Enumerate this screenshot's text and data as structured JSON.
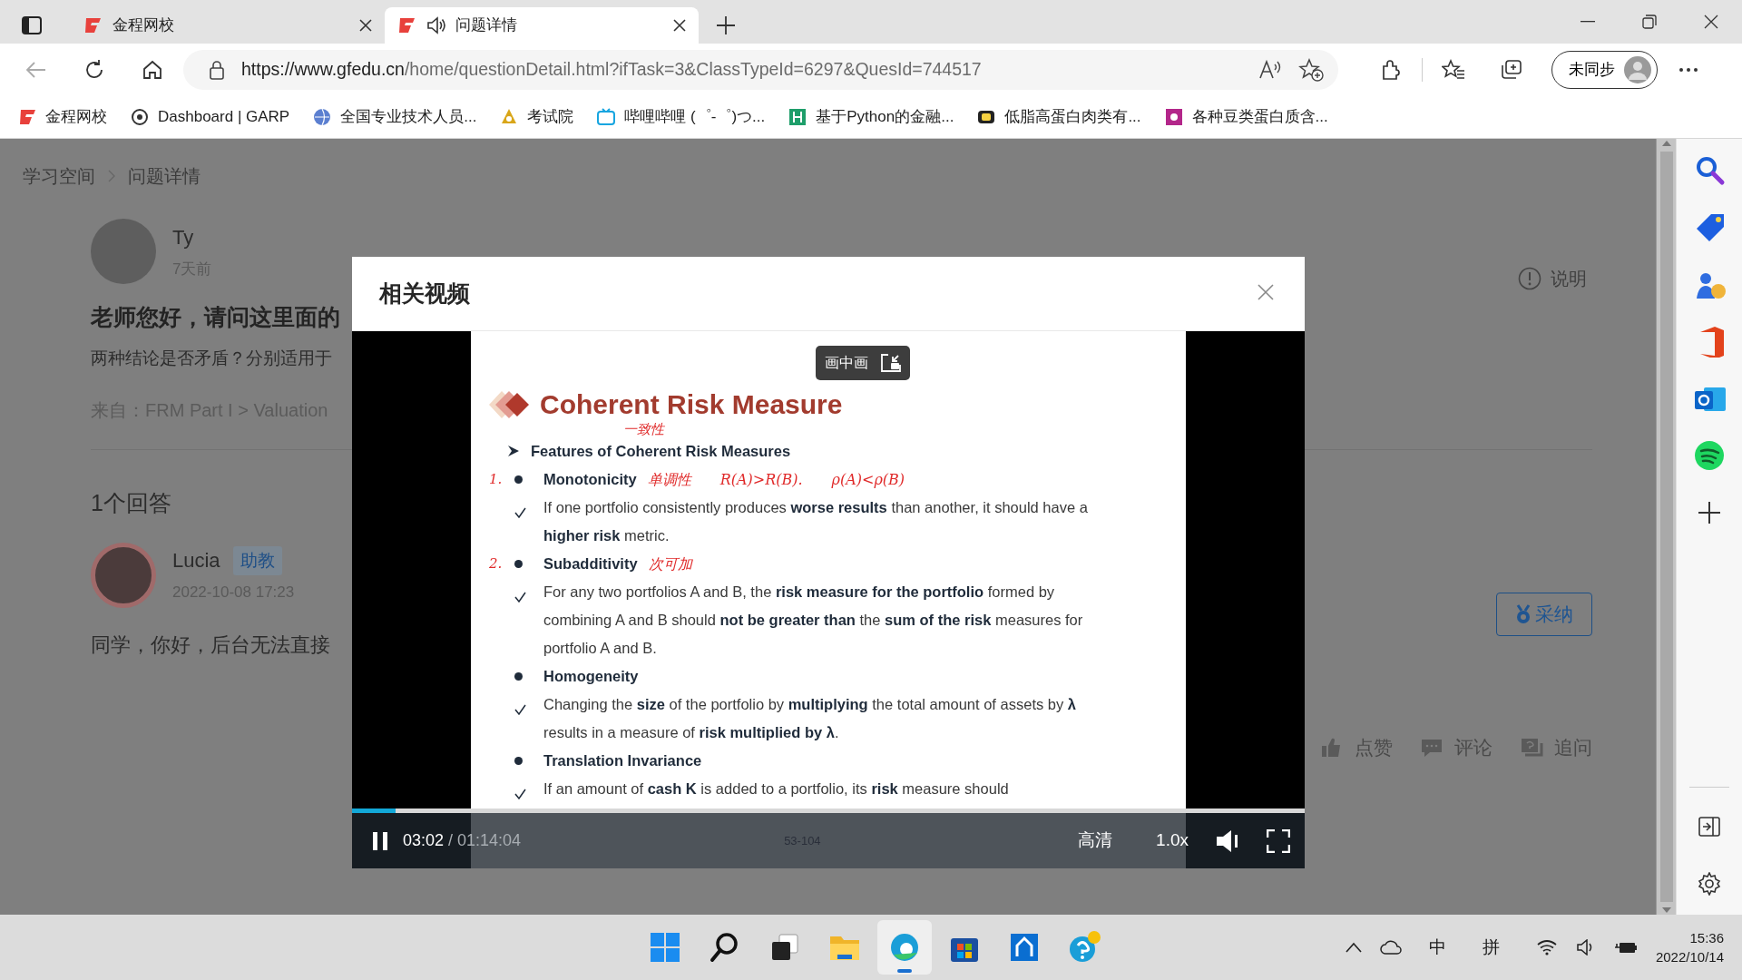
{
  "browser": {
    "tabs": [
      {
        "title": "金程网校",
        "selected": false,
        "audio": false
      },
      {
        "title": "问题详情",
        "selected": true,
        "audio": true
      }
    ],
    "address": {
      "host": "https://www.gfedu.cn",
      "path": "/home/questionDetail.html?ifTask=3&ClassTypeId=6297&QuesId=744517"
    },
    "profile": "未同步",
    "bookmarks": [
      {
        "title": "金程网校"
      },
      {
        "title": "Dashboard | GARP"
      },
      {
        "title": "全国专业技术人员..."
      },
      {
        "title": "考试院"
      },
      {
        "title": "哔哩哔哩 (゜-゜)つ..."
      },
      {
        "title": "基于Python的金融..."
      },
      {
        "title": "低脂高蛋白肉类有..."
      },
      {
        "title": "各种豆类蛋白质含..."
      }
    ]
  },
  "page": {
    "breadcrumb": [
      "学习空间",
      "问题详情"
    ],
    "help": "说明",
    "question": {
      "author": "Ty",
      "time": "7天前",
      "title": "老师您好，请问这里面的",
      "body": "两种结论是否矛盾？分别适用于",
      "source": "来自：FRM Part I > Valuation"
    },
    "answers_heading": "1个回答",
    "answer": {
      "author": "Lucia",
      "role": "助教",
      "time": "2022-10-08 17:23",
      "text": "同学，你好，后台无法直接",
      "accept": "采纳",
      "actions": [
        "点赞",
        "评论",
        "追问"
      ]
    }
  },
  "modal": {
    "title": "相关视频",
    "video": {
      "pip": "画中画",
      "playing": true,
      "current": "03:02",
      "duration": "/ 01:14:04",
      "level": 0.046,
      "page": "53-104",
      "quality": "高清",
      "speed": "1.0x",
      "slide": {
        "title": "Coherent Risk Measure",
        "items": [
          {
            "kind": "heading",
            "text": "**Features of Coherent Risk Measures**",
            "note": "一致性"
          },
          {
            "kind": "bullet",
            "text": "**Monotonicity**",
            "mark": "1.",
            "notes": [
              "单调性",
              "R(A)>R(B).",
              "ρ(A)<ρ(B)"
            ]
          },
          {
            "kind": "check",
            "text": "If one portfolio consistently produces **worse results** than another, it should have a **higher risk** metric."
          },
          {
            "kind": "bullet",
            "text": "**Subadditivity**",
            "mark": "2.",
            "notes": [
              "次可加"
            ]
          },
          {
            "kind": "check",
            "text": "For any two portfolios A and B, the **risk measure for the portfolio** formed by combining A and B should **not be greater than** the **sum of the risk** measures for portfolio A and B."
          },
          {
            "kind": "bullet",
            "text": "**Homogeneity**"
          },
          {
            "kind": "check",
            "text": "Changing the **size** of the portfolio by **multiplying** the total amount of assets by **λ** results in a measure of **risk multiplied by λ**."
          },
          {
            "kind": "bullet",
            "text": "**Translation Invariance**"
          },
          {
            "kind": "check",
            "text": "If an amount of **cash K** is added to a portfolio, its **risk** measure should"
          }
        ]
      }
    }
  },
  "taskbar": {
    "input_mode": "中",
    "ime": "拼",
    "time": "15:36",
    "date": "2022/10/14"
  }
}
